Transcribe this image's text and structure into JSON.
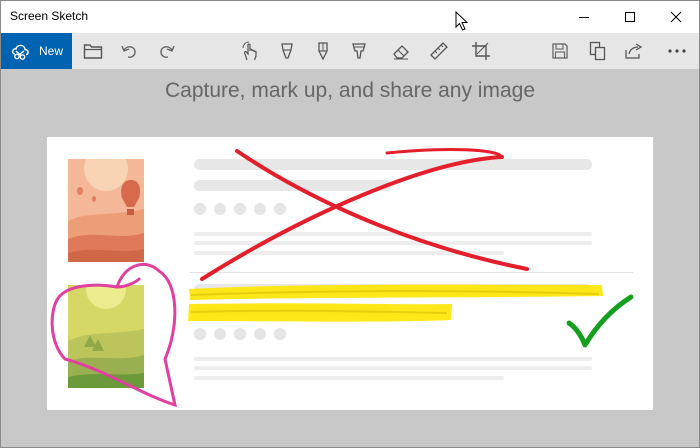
{
  "window": {
    "title": "Screen Sketch",
    "controls": {
      "minimize": "minimize-icon",
      "maximize": "maximize-icon",
      "close": "close-icon"
    }
  },
  "toolbar": {
    "new_label": "New",
    "accent_color": "#0063b1",
    "tools": [
      "open-folder-icon",
      "undo-icon",
      "redo-icon",
      "touch-writing-icon",
      "ballpoint-pen-icon",
      "pencil-icon",
      "highlighter-icon",
      "eraser-icon",
      "ruler-icon",
      "crop-icon",
      "save-icon",
      "copy-icon",
      "share-icon",
      "more-icon"
    ]
  },
  "canvas": {
    "headline": "Capture, mark up, and share any image",
    "annotations": {
      "cross_color": "#e41e2b",
      "highlight_color": "#ffe600",
      "heart_color": "#e040a0",
      "check_color": "#14a01e"
    }
  }
}
